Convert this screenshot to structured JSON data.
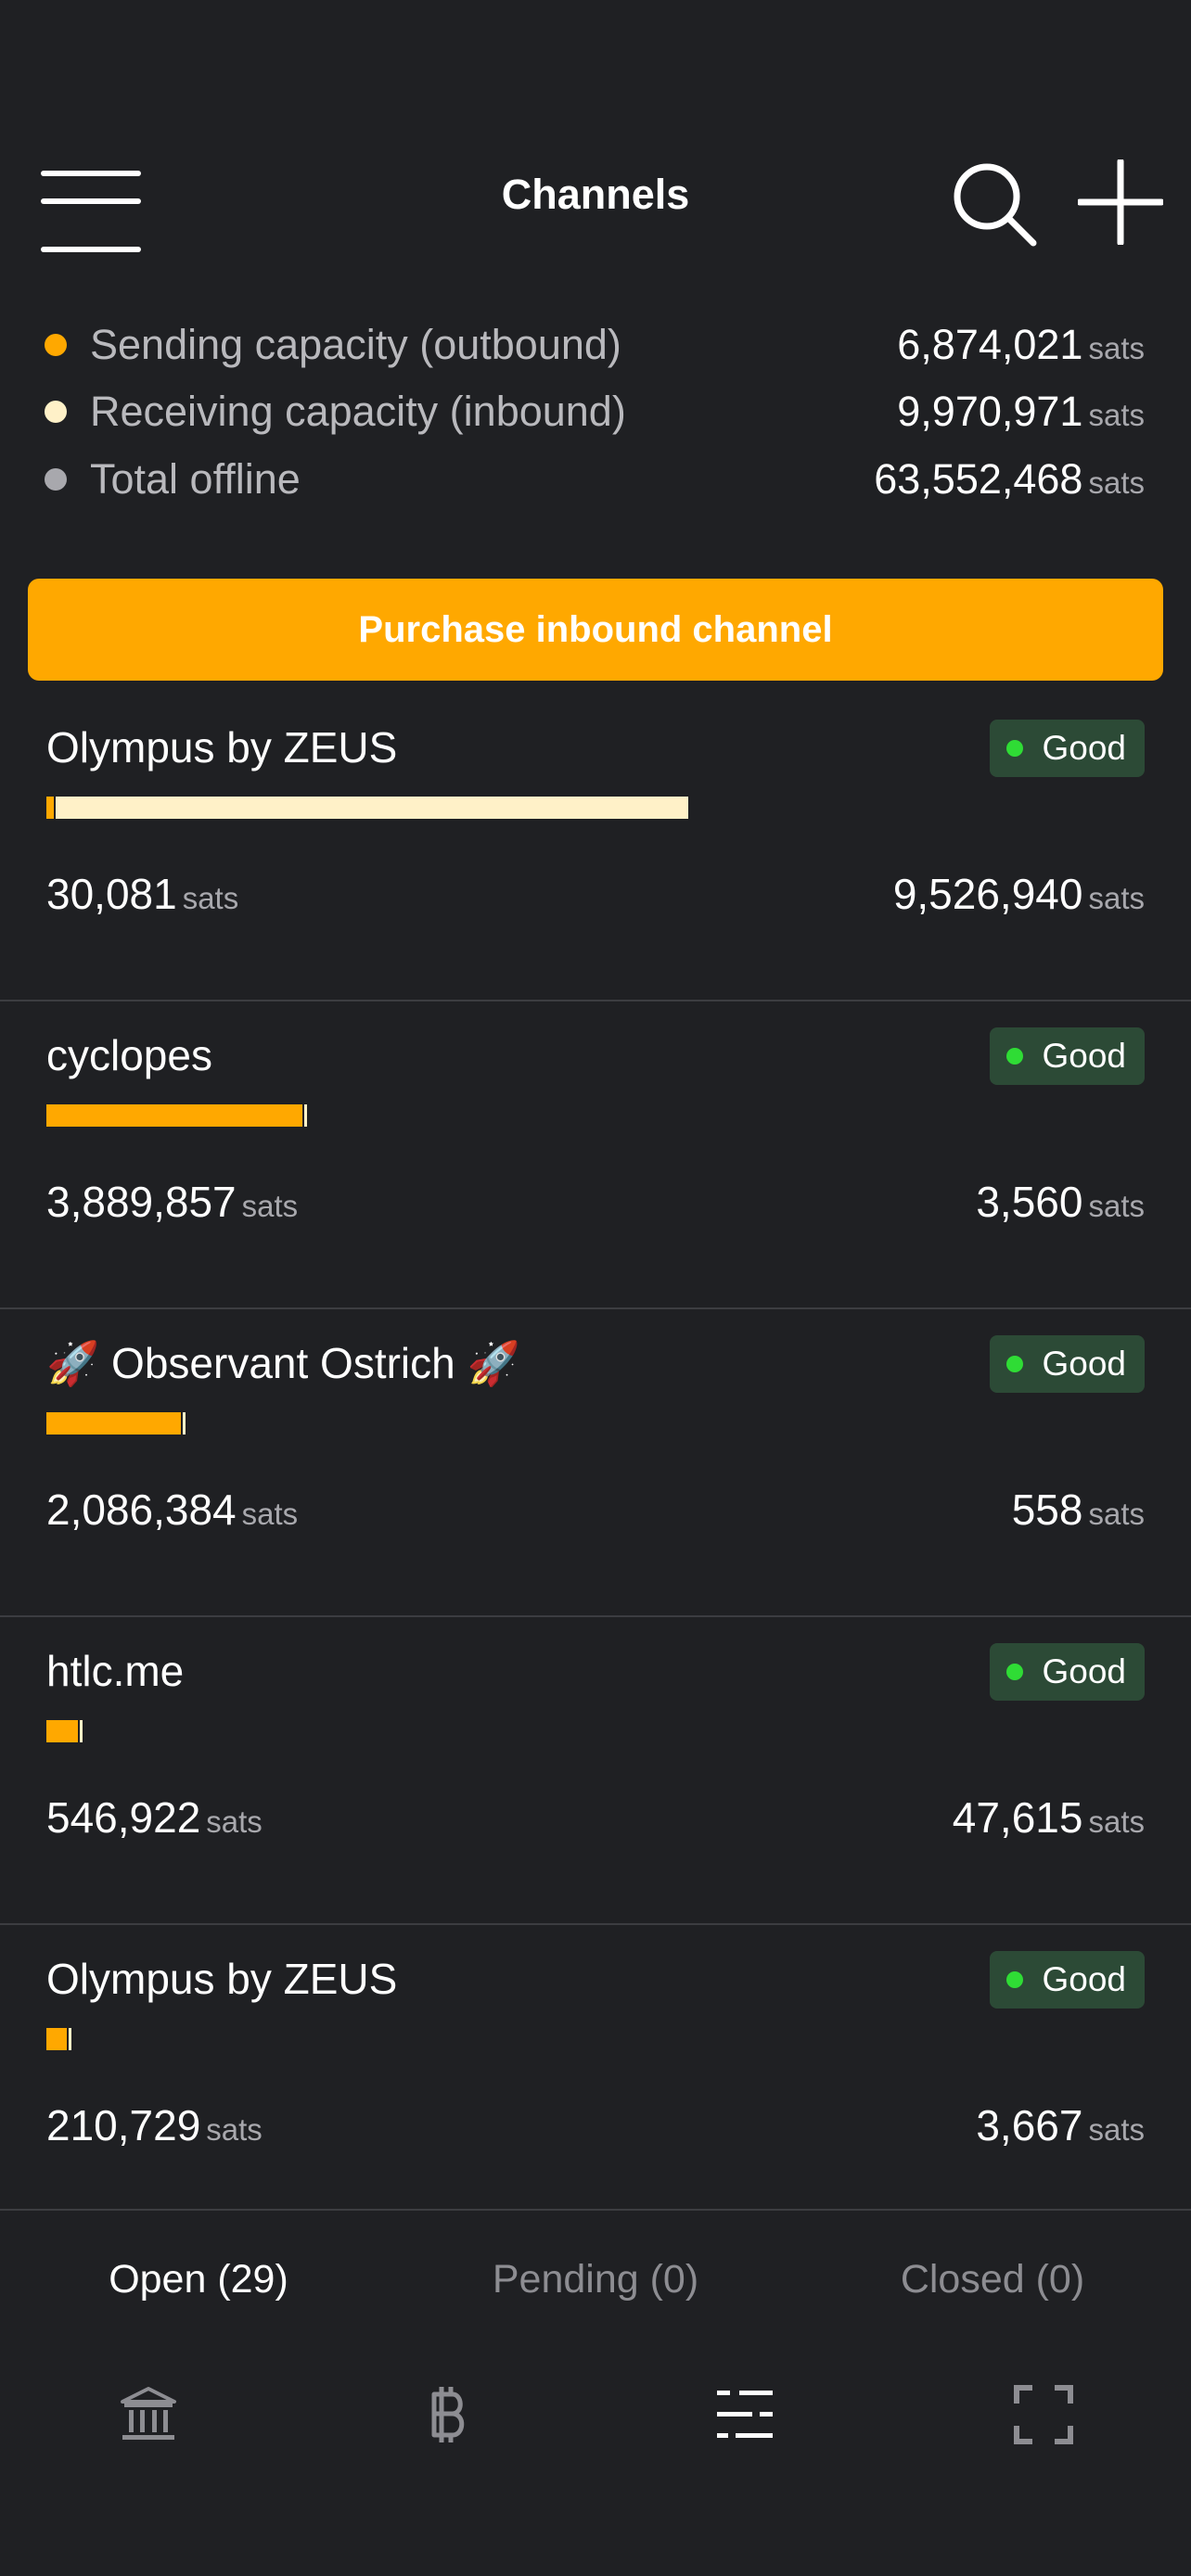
{
  "header": {
    "title": "Channels"
  },
  "capacity": [
    {
      "label": "Sending capacity (outbound)",
      "value": "6,874,021",
      "unit": "sats",
      "color": "#ffa800"
    },
    {
      "label": "Receiving capacity (inbound)",
      "value": "9,970,971",
      "unit": "sats",
      "color": "#fff1c8"
    },
    {
      "label": "Total offline",
      "value": "63,552,468",
      "unit": "sats",
      "color": "#a8a8ad"
    }
  ],
  "purchase_button": "Purchase inbound channel",
  "channels": [
    {
      "name": "Olympus by ZEUS",
      "status": "Good",
      "local": "30,081",
      "remote": "9,526,940",
      "unit": "sats",
      "local_fraction": 0.003
    },
    {
      "name": "cyclopes",
      "status": "Good",
      "local": "3,889,857",
      "remote": "3,560",
      "unit": "sats",
      "local_fraction": 0.999
    },
    {
      "name": "🚀 Observant Ostrich 🚀",
      "status": "Good",
      "local": "2,086,384",
      "remote": "558",
      "unit": "sats",
      "local_fraction": 0.9997
    },
    {
      "name": "htlc.me",
      "status": "Good",
      "local": "546,922",
      "remote": "47,615",
      "unit": "sats",
      "local_fraction": 0.92
    },
    {
      "name": "Olympus by ZEUS",
      "status": "Good",
      "local": "210,729",
      "remote": "3,667",
      "unit": "sats",
      "local_fraction": 0.983
    }
  ],
  "tabs": [
    {
      "label": "Open (29)",
      "active": true
    },
    {
      "label": "Pending (0)",
      "active": false
    },
    {
      "label": "Closed (0)",
      "active": false
    }
  ],
  "nav_icons": [
    "bank-icon",
    "bitcoin-icon",
    "channels-icon",
    "scan-icon"
  ],
  "colors": {
    "accent": "#ffa800",
    "inbound": "#fff1c8",
    "good": "#2fdc35",
    "badge_bg": "#2c4a36",
    "background": "#1f2023"
  }
}
